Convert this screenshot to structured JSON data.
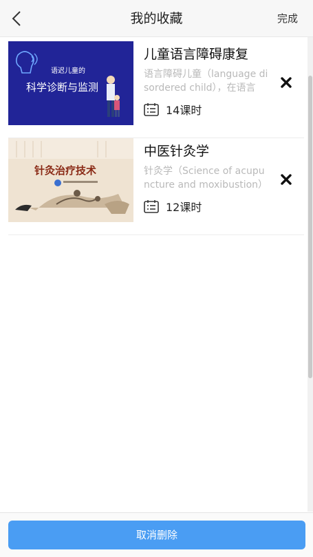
{
  "header": {
    "title": "我的收藏",
    "done_label": "完成"
  },
  "courses": [
    {
      "title": "儿童语言障碍康复",
      "description": "语言障碍儿童（language disordered child），在语言",
      "lessons": "14课时",
      "thumb_text_top": "语迟儿童的",
      "thumb_text_main": "科学诊断与监测",
      "thumb_bg": "#1d1f8f"
    },
    {
      "title": "中医针灸学",
      "description": "针灸学（Science of acupuncture and moxibustion）是以中",
      "lessons": "12课时",
      "thumb_text_main": "针灸治疗技术",
      "thumb_bg": "#efe3d2"
    }
  ],
  "footer": {
    "cancel_label": "取消删除"
  },
  "colors": {
    "accent": "#4a9df3",
    "thumb1_text": "#ffffff",
    "thumb2_text": "#8a2a16"
  }
}
